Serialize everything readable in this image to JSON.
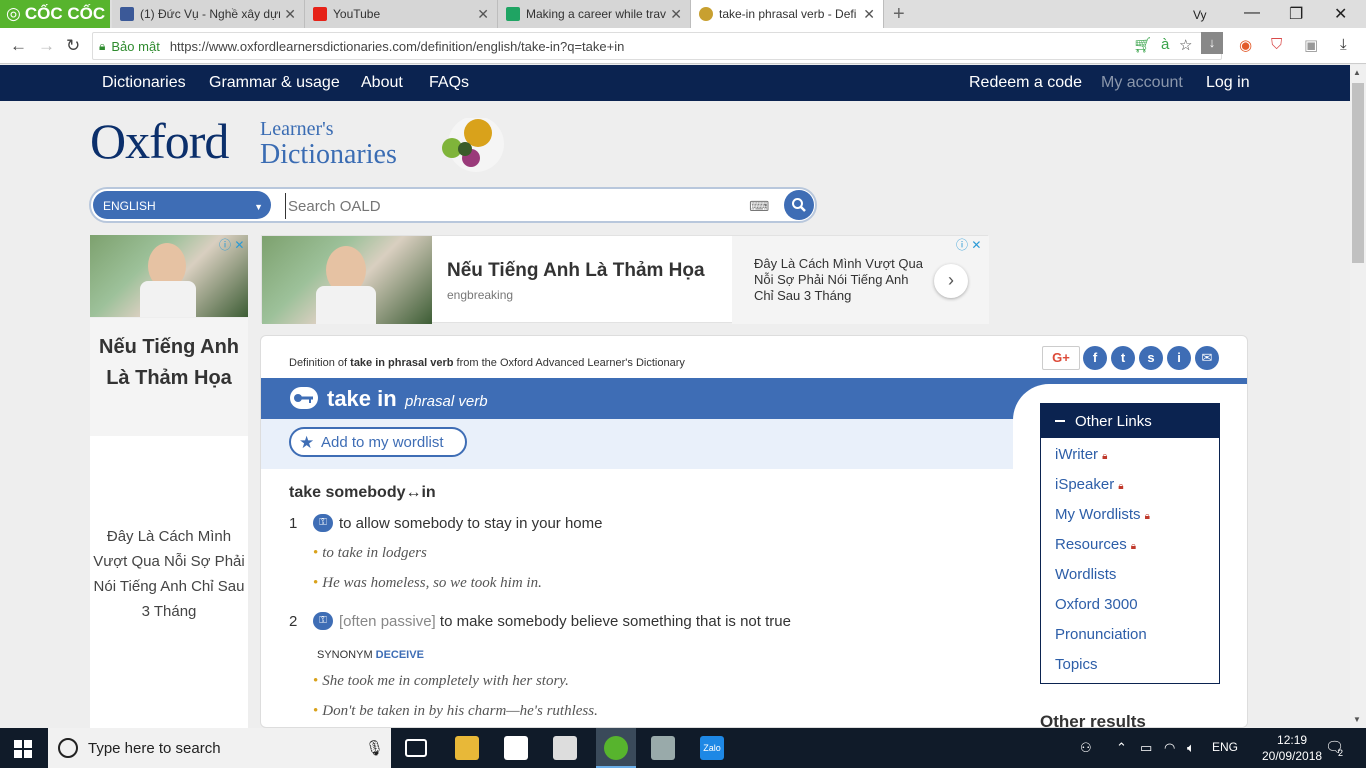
{
  "browser": {
    "brand": "CỐC CỐC",
    "tabs": [
      {
        "title": "(1) Đức Vụ - Nghề xây dựng",
        "color": "#3b5998"
      },
      {
        "title": "YouTube",
        "color": "#e62117"
      },
      {
        "title": "Making a career while trav",
        "color": "#1fa463"
      },
      {
        "title": "take-in phrasal verb - Defi",
        "color": "#c8a030"
      }
    ],
    "profile": "Vy",
    "secure_label": "Bảo mật",
    "url": "https://www.oxfordlearnersdictionaries.com/definition/english/take-in?q=take+in"
  },
  "site_nav": {
    "left": [
      "Dictionaries",
      "Grammar & usage",
      "About",
      "FAQs"
    ],
    "redeem": "Redeem a code",
    "account": "My account",
    "login": "Log in"
  },
  "logo": {
    "oxford": "Oxford",
    "line1": "Learner's",
    "line2": "Dictionaries"
  },
  "search": {
    "language": "ENGLISH",
    "placeholder": "Search OALD"
  },
  "ads": {
    "left_title": "Nếu Tiếng Anh Là Thảm Họa",
    "left_body": "Đây Là Cách Mình Vượt Qua Nỗi Sợ Phải Nói Tiếng Anh Chỉ Sau 3 Tháng",
    "top_title": "Nếu Tiếng Anh Là Thảm Họa",
    "top_source": "engbreaking",
    "top_body": "Đây Là Cách Mình Vượt Qua Nỗi Sợ Phải Nói Tiếng Anh Chỉ Sau 3 Tháng"
  },
  "entry": {
    "crumb_prefix": "Definition of",
    "crumb_word": "take in phrasal verb",
    "crumb_suffix": "from the Oxford Advanced Learner's Dictionary",
    "headword": "take in",
    "pos": "phrasal verb",
    "wordlist_button": "Add to my wordlist",
    "phrase": "take somebody↔in",
    "senses": [
      {
        "num": "1",
        "gram": "",
        "def": "to allow somebody to stay in your home",
        "examples": [
          "to take in lodgers",
          "He was homeless, so we took him in."
        ]
      },
      {
        "num": "2",
        "gram": "[often passive]",
        "def": "to make somebody believe something that is not true",
        "synonym_label": "SYNONYM",
        "synonym": "DECEIVE",
        "examples": [
          "She took me in completely with her story.",
          "Don't be taken in by his charm—he's ruthless."
        ]
      }
    ]
  },
  "other_links": {
    "title": "Other Links",
    "items": [
      {
        "label": "iWriter",
        "locked": true
      },
      {
        "label": "iSpeaker",
        "locked": true
      },
      {
        "label": "My Wordlists",
        "locked": true
      },
      {
        "label": "Resources",
        "locked": true
      },
      {
        "label": "Wordlists",
        "locked": false
      },
      {
        "label": "Oxford 3000",
        "locked": false
      },
      {
        "label": "Pronunciation",
        "locked": false
      },
      {
        "label": "Topics",
        "locked": false
      }
    ],
    "other_results": "Other results"
  },
  "taskbar": {
    "search_placeholder": "Type here to search",
    "language": "ENG",
    "time": "12:19",
    "date": "20/09/2018",
    "notifications": "2"
  },
  "colors": {
    "accent": "#3e6db5",
    "navy": "#0b2350",
    "gold": "#d9a21b"
  }
}
